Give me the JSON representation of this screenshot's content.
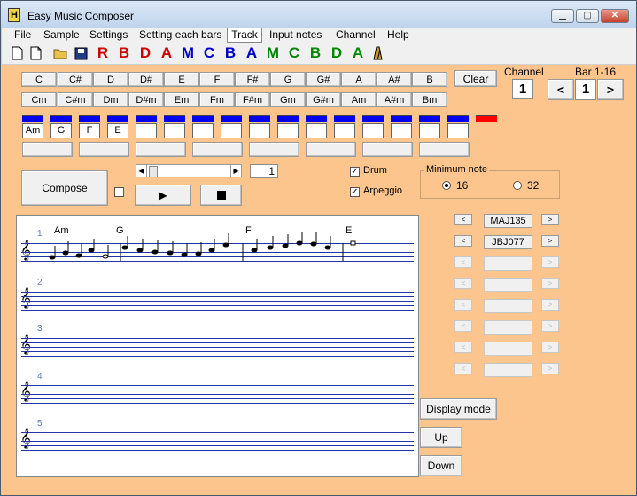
{
  "window": {
    "title": "Easy Music Composer",
    "icon": "H"
  },
  "menu": [
    "File",
    "Sample",
    "Settings",
    "Setting each bars",
    "Track",
    "Input notes",
    "Channel",
    "Help"
  ],
  "toolbar": {
    "letters": [
      {
        "t": "R",
        "c": "#cc0000"
      },
      {
        "t": "B",
        "c": "#cc0000"
      },
      {
        "t": "D",
        "c": "#cc0000"
      },
      {
        "t": "A",
        "c": "#cc0000"
      },
      {
        "t": "M",
        "c": "#0000cc"
      },
      {
        "t": "C",
        "c": "#0000cc"
      },
      {
        "t": "B",
        "c": "#0000cc"
      },
      {
        "t": "A",
        "c": "#0000cc"
      },
      {
        "t": "M",
        "c": "#008800"
      },
      {
        "t": "C",
        "c": "#008800"
      },
      {
        "t": "B",
        "c": "#008800"
      },
      {
        "t": "D",
        "c": "#008800"
      },
      {
        "t": "A",
        "c": "#008800"
      }
    ]
  },
  "chords": {
    "major": [
      "C",
      "C#",
      "D",
      "D#",
      "E",
      "F",
      "F#",
      "G",
      "G#",
      "A",
      "A#",
      "B"
    ],
    "minor": [
      "Cm",
      "C#m",
      "Dm",
      "D#m",
      "Em",
      "Fm",
      "F#m",
      "Gm",
      "G#m",
      "Am",
      "A#m",
      "Bm"
    ],
    "clear": "Clear"
  },
  "channel": {
    "label": "Channel",
    "value": "1"
  },
  "bars": {
    "label": "Bar 1-16",
    "prev": "<",
    "value": "1",
    "next": ">"
  },
  "track": [
    "Am",
    "G",
    "F",
    "E",
    "",
    "",
    "",
    "",
    "",
    "",
    "",
    "",
    "",
    "",
    "",
    ""
  ],
  "compose": "Compose",
  "position": "1",
  "drum": "Drum",
  "arpeggio": "Arpeggio",
  "min_note": {
    "label": "Minimum note",
    "options": [
      "16",
      "32"
    ],
    "selected": "16"
  },
  "score": {
    "staves": [
      "1",
      "2",
      "3",
      "4",
      "5"
    ],
    "chords": [
      "Am",
      "G",
      "F",
      "E"
    ]
  },
  "patterns": [
    "MAJ135",
    "JBJ077",
    "",
    "",
    "",
    "",
    "",
    ""
  ],
  "buttons": {
    "display_mode": "Display mode",
    "up": "Up",
    "down": "Down"
  },
  "colors": {
    "window_bg": "#fcc58e",
    "track_bar": "#0000ee",
    "track_active": "#ff0000",
    "staff": "#2233aa"
  }
}
